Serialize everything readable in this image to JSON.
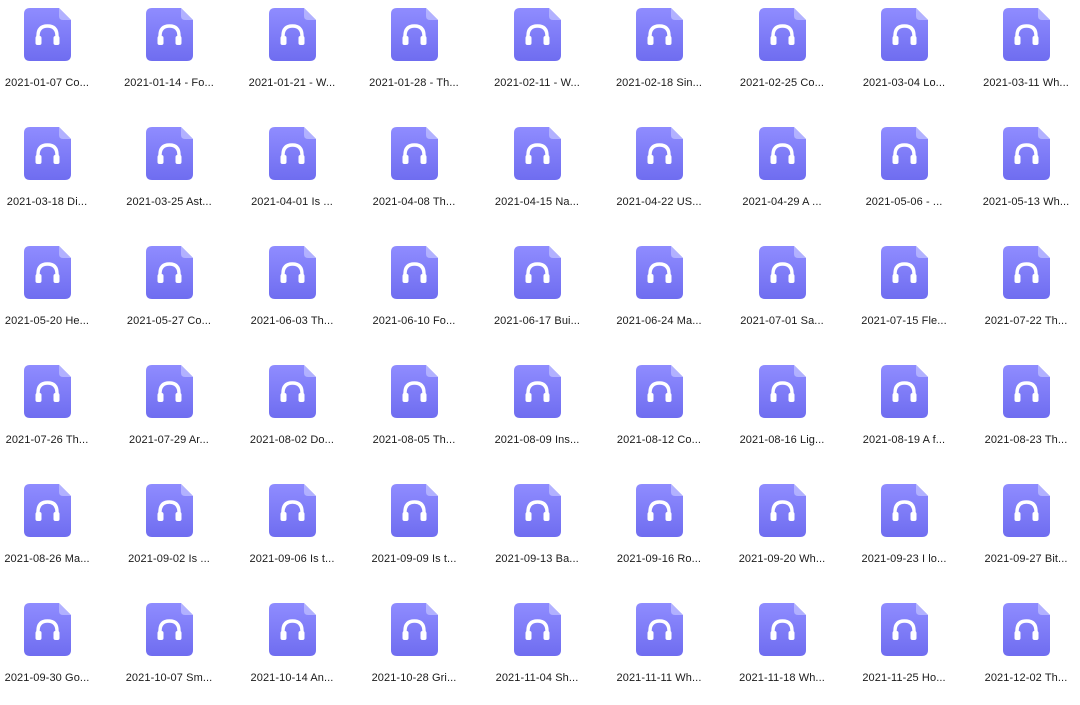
{
  "icon": {
    "name": "audio-file-icon",
    "color_top": "#8f8cff",
    "color_bottom": "#6f6df0",
    "glyph_color": "#ffffff",
    "glyph": "headphones-icon"
  },
  "files": [
    "2021-01-07  Co...",
    "2021-01-14 - Fo...",
    "2021-01-21 - W...",
    "2021-01-28 - Th...",
    "2021-02-11 - W...",
    "2021-02-18  Sin...",
    "2021-02-25  Co...",
    "2021-03-04  Lo...",
    "2021-03-11  Wh...",
    "2021-03-18  Di...",
    "2021-03-25  Ast...",
    "2021-04-01  Is ...",
    "2021-04-08  Th...",
    "2021-04-15  Na...",
    "2021-04-22  US...",
    "2021-04-29  A ...",
    "2021-05-06  - ...",
    "2021-05-13  Wh...",
    "2021-05-20  He...",
    "2021-05-27  Co...",
    "2021-06-03  Th...",
    "2021-06-10  Fo...",
    "2021-06-17  Bui...",
    "2021-06-24  Ma...",
    "2021-07-01  Sa...",
    "2021-07-15  Fle...",
    "2021-07-22  Th...",
    "2021-07-26  Th...",
    "2021-07-29  Ar...",
    "2021-08-02  Do...",
    "2021-08-05  Th...",
    "2021-08-09  Ins...",
    "2021-08-12  Co...",
    "2021-08-16  Lig...",
    "2021-08-19  A f...",
    "2021-08-23  Th...",
    "2021-08-26  Ma...",
    "2021-09-02  Is ...",
    "2021-09-06  Is t...",
    "2021-09-09  Is t...",
    "2021-09-13  Ba...",
    "2021-09-16  Ro...",
    "2021-09-20  Wh...",
    "2021-09-23  I lo...",
    "2021-09-27  Bit...",
    "2021-09-30  Go...",
    "2021-10-07  Sm...",
    "2021-10-14  An...",
    "2021-10-28  Gri...",
    "2021-11-04  Sh...",
    "2021-11-11  Wh...",
    "2021-11-18  Wh...",
    "2021-11-25 Ho...",
    "2021-12-02  Th..."
  ]
}
